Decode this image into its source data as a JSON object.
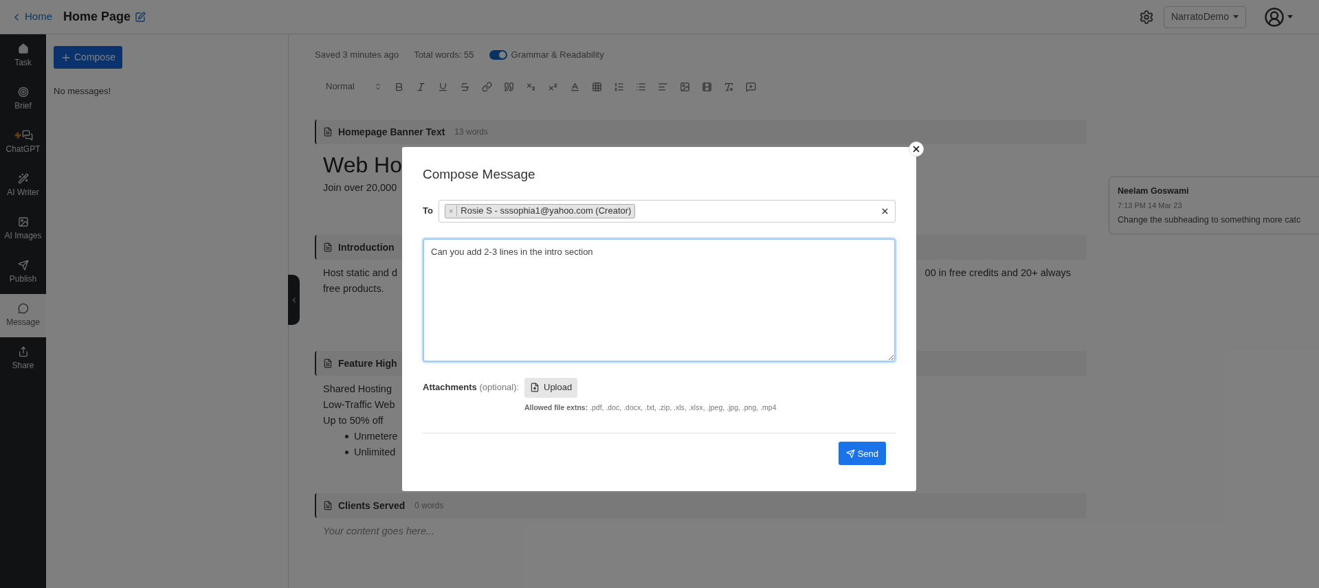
{
  "top_bar": {
    "back_link": "Home",
    "page_title": "Home Page",
    "workspace": "NarratoDemo"
  },
  "sidebar": {
    "items": [
      {
        "label": "Task",
        "kind": "home",
        "selected": false
      },
      {
        "label": "Brief",
        "kind": "target",
        "selected": false
      },
      {
        "label": "ChatGPT",
        "kind": "chat",
        "selected": false
      },
      {
        "label": "AI Writer",
        "kind": "wand",
        "selected": false
      },
      {
        "label": "AI Images",
        "kind": "image",
        "selected": false
      },
      {
        "label": "Publish",
        "kind": "send",
        "selected": false
      },
      {
        "label": "Message",
        "kind": "message",
        "selected": true
      },
      {
        "label": "Share",
        "kind": "share",
        "selected": false
      }
    ]
  },
  "messages_panel": {
    "compose_button": "Compose",
    "empty_text": "No messages!"
  },
  "editor": {
    "saved": "Saved 3 minutes ago",
    "total_words": "Total words: 55",
    "grammar_toggle": {
      "label": "Grammar & Readability",
      "on": true
    },
    "style_select": "Normal",
    "sections": [
      {
        "title": "Homepage Banner Text",
        "word_count": "13 words",
        "blocks": [
          {
            "kind": "heading",
            "text": "Web Ho"
          },
          {
            "kind": "paragraph",
            "text": "Join over 20,000"
          }
        ]
      },
      {
        "title": "Introduction",
        "blocks": [
          {
            "kind": "paragraph",
            "text": "Host static and d",
            "text_right": "00 in free credits and 20+ always"
          },
          {
            "kind": "paragraph",
            "text": "free products."
          }
        ]
      },
      {
        "title": "Feature High",
        "blocks": [
          {
            "kind": "paragraph",
            "text": "Shared Hosting"
          },
          {
            "kind": "paragraph",
            "text": "Low-Traffic Web"
          },
          {
            "kind": "paragraph",
            "text": "Up to 50% off"
          },
          {
            "kind": "bullet",
            "text": "Unmetere"
          },
          {
            "kind": "bullet",
            "text": "Unlimited"
          }
        ]
      },
      {
        "title": "Clients Served",
        "word_count": "0 words",
        "blocks": [
          {
            "kind": "placeholder",
            "text": "Your content goes here..."
          }
        ]
      }
    ]
  },
  "comment": {
    "author": "Neelam Goswami",
    "time": "7:13 PM 14 Mar 23",
    "text": "Change the subheading to something more catc"
  },
  "modal": {
    "title": "Compose Message",
    "to_label": "To",
    "recipients": [
      {
        "remove": "×",
        "label": "Rosie S - sssophia1@yahoo.com (Creator)"
      }
    ],
    "message": "Can you add 2-3 lines in the intro section",
    "attachments_label": "Attachments",
    "attachments_hint": "(optional):",
    "upload_button": "Upload",
    "allowed_label": "Allowed file extns:",
    "allowed_types": ".pdf, .doc, .docx, .txt, .zip, .xls, .xlsx, .jpeg, .jpg, .png, .mp4",
    "send_button": "Send"
  }
}
